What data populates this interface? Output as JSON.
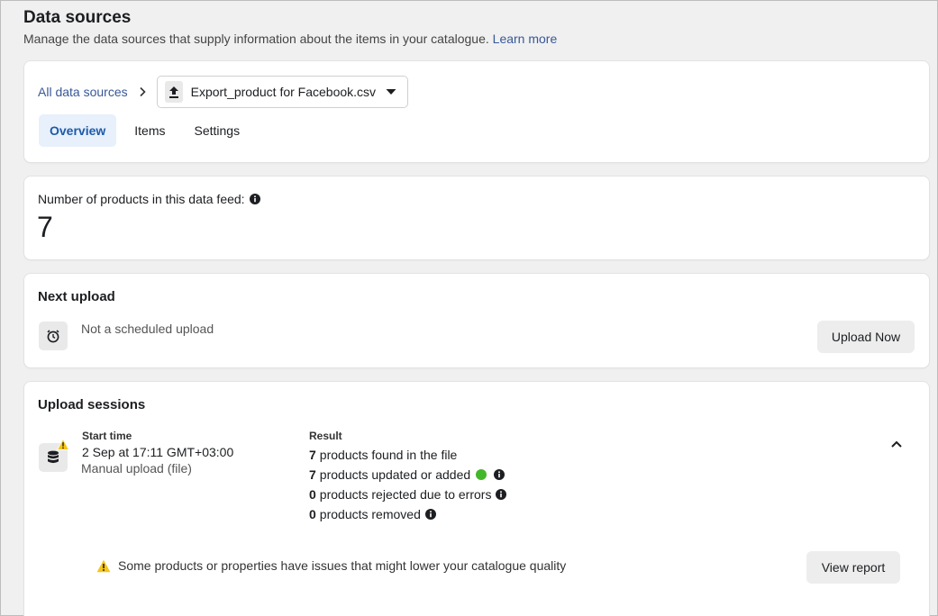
{
  "header": {
    "title": "Data sources",
    "subtitle": "Manage the data sources that supply information about the items in your catalogue.",
    "learn_more": "Learn more"
  },
  "source_card": {
    "breadcrumb_root": "All data sources",
    "selected_file": "Export_product for Facebook.csv",
    "tabs": [
      {
        "label": "Overview",
        "active": true
      },
      {
        "label": "Items",
        "active": false
      },
      {
        "label": "Settings",
        "active": false
      }
    ]
  },
  "products_card": {
    "label": "Number of products in this data feed:",
    "count": "7"
  },
  "next_upload": {
    "title": "Next upload",
    "status": "Not a scheduled upload",
    "button": "Upload Now"
  },
  "upload_sessions": {
    "title": "Upload sessions",
    "start_label": "Start time",
    "start_time": "2 Sep at 17:11 GMT+03:00",
    "method": "Manual upload (file)",
    "result_label": "Result",
    "results": [
      {
        "count": "7",
        "text": "products found in the file"
      },
      {
        "count": "7",
        "text": "products updated or added"
      },
      {
        "count": "0",
        "text": "products rejected due to errors"
      },
      {
        "count": "0",
        "text": "products removed"
      }
    ],
    "warning": "Some products or properties have issues that might lower your catalogue quality",
    "view_report": "View report"
  },
  "colors": {
    "link": "#385898",
    "active_tab_bg": "#e7f0fb",
    "success": "#42b72a",
    "warning": "#f5c518"
  },
  "icons": [
    "upload-icon",
    "chevron-right-icon",
    "caret-down-icon",
    "info-icon",
    "alarm-clock-icon",
    "database-icon",
    "warning-icon",
    "chevron-up-icon"
  ]
}
